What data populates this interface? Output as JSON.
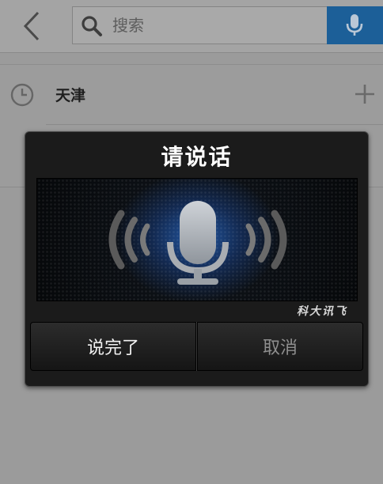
{
  "search": {
    "placeholder": "搜索"
  },
  "history": {
    "items": [
      {
        "label": "天津"
      }
    ]
  },
  "dialog": {
    "title": "请说话",
    "brand": "科大讯飞",
    "buttons": {
      "done": "说完了",
      "cancel": "取消"
    }
  },
  "colors": {
    "voice_button": "#1c5f98",
    "overlay_gray": "#9b9b9b",
    "dialog_bg": "#1b1b1b",
    "mic_glow": "#2b6fd0"
  },
  "icons": {
    "back": "chevron-left-icon",
    "search": "search-icon",
    "voice": "microphone-icon",
    "history": "clock-icon",
    "add": "plus-icon",
    "panel_mic": "microphone-icon"
  }
}
